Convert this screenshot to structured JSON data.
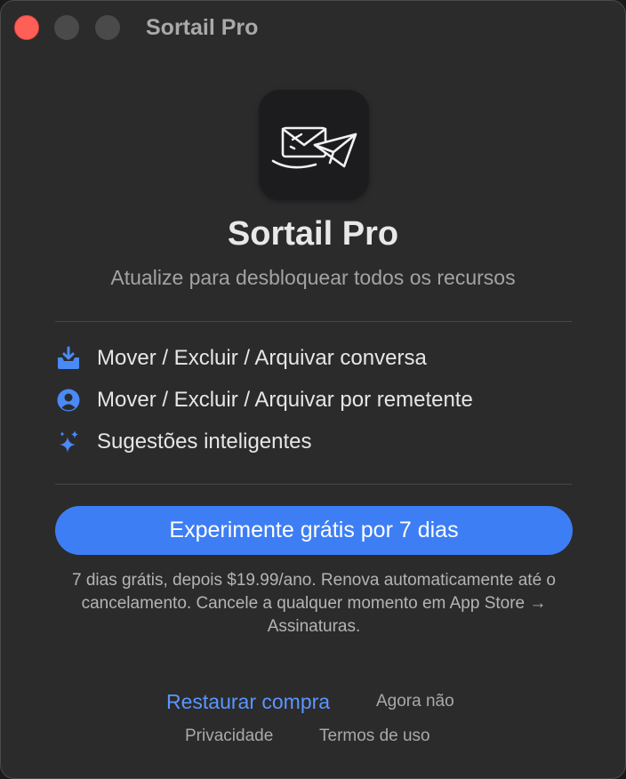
{
  "window": {
    "title": "Sortail Pro"
  },
  "app": {
    "icon": "mail-envelopes-icon",
    "name": "Sortail Pro",
    "subtitle": "Atualize para desbloquear todos os recursos"
  },
  "features": [
    {
      "icon": "inbox-download-icon",
      "label": "Mover / Excluir / Arquivar conversa"
    },
    {
      "icon": "person-circle-icon",
      "label": "Mover / Excluir / Arquivar por remetente"
    },
    {
      "icon": "sparkles-icon",
      "label": "Sugestões inteligentes"
    }
  ],
  "cta": {
    "label": "Experimente grátis por 7 dias"
  },
  "fineprint": "7 dias grátis, depois $19.99/ano. Renova automaticamente até o cancelamento. Cancele a qualquer momento em App Store → Assinaturas.",
  "links": {
    "restore": "Restaurar compra",
    "not_now": "Agora não",
    "privacy": "Privacidade",
    "terms": "Termos de uso"
  },
  "colors": {
    "accent": "#3d7ef5",
    "link": "#5a96ff",
    "close": "#fe5f57",
    "background": "#2b2b2b"
  }
}
